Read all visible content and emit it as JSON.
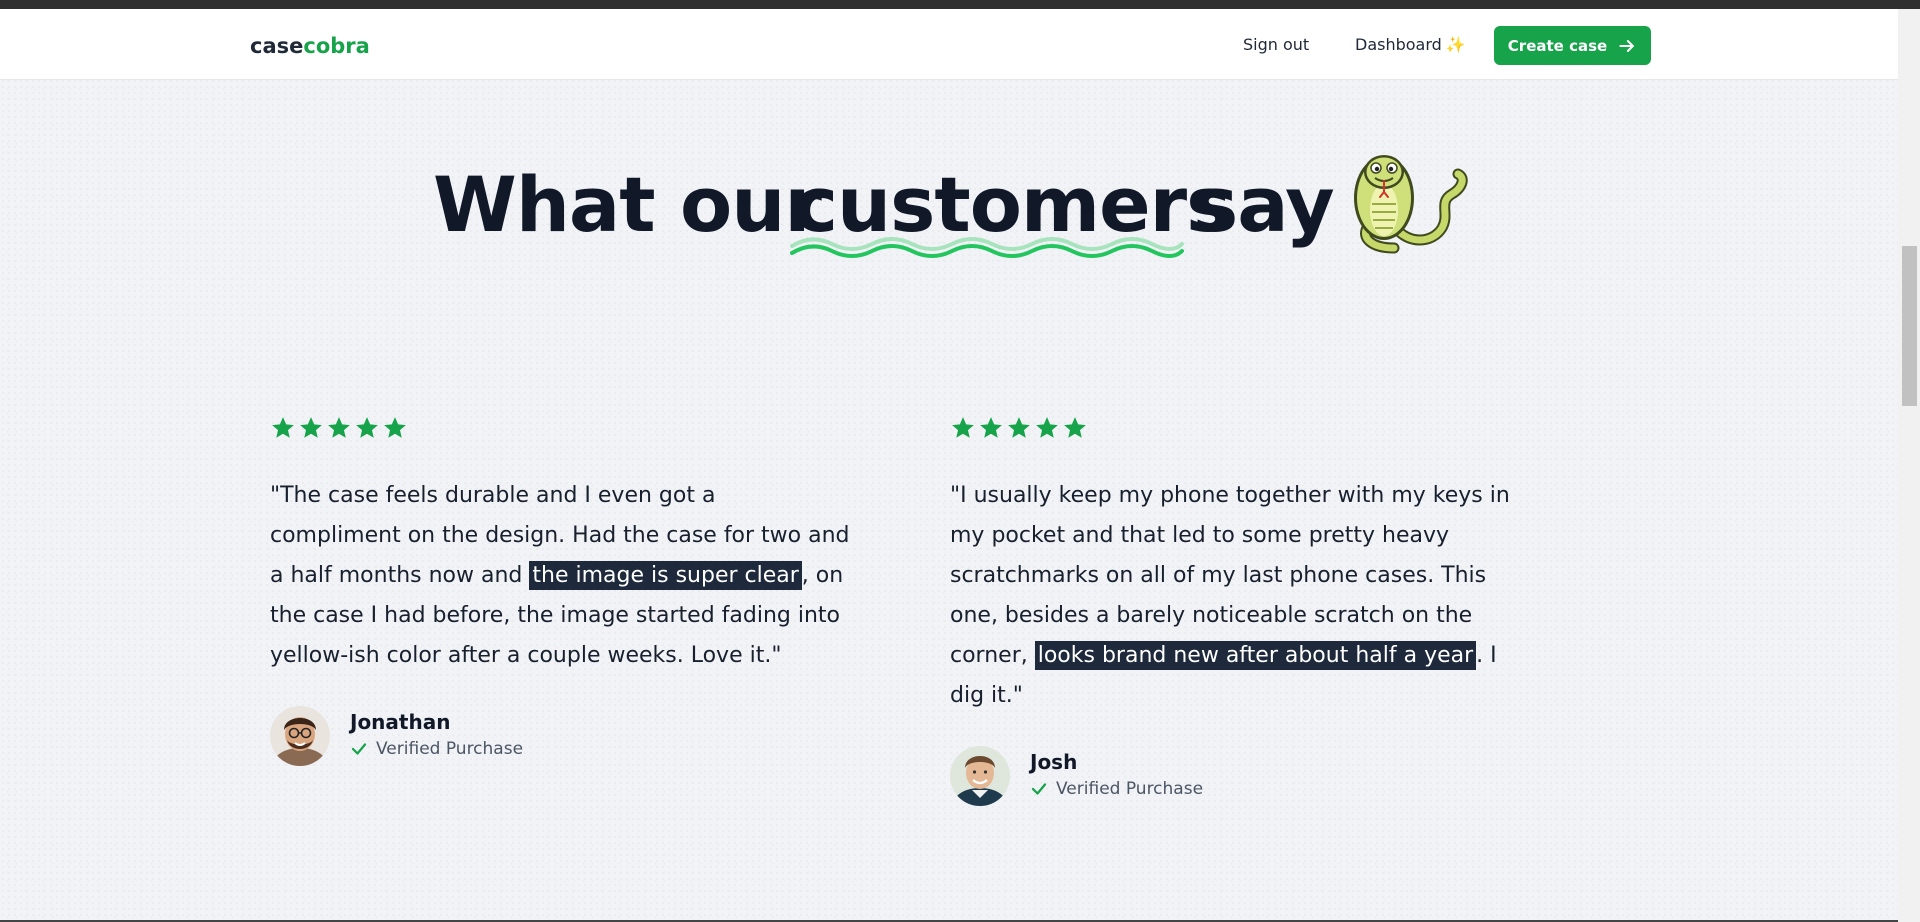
{
  "nav": {
    "logo_part1": "case",
    "logo_part2": "cobra",
    "signout": "Sign out",
    "dashboard": "Dashboard",
    "dashboard_icon": "✨",
    "create_case": "Create case"
  },
  "heading": {
    "part1": "What our",
    "highlight": "customers",
    "part2": "say"
  },
  "reviews": [
    {
      "rating": 5,
      "quote_before": "\"The case feels durable and I even got a compliment on the design. Had the case for two and a half months now and ",
      "quote_highlight": "the image is super clear",
      "quote_after": ", on the case I had before, the image started fading into yellow-ish color after a couple weeks. Love it.\"",
      "name": "Jonathan",
      "verified": "Verified Purchase"
    },
    {
      "rating": 5,
      "quote_before": "\"I usually keep my phone together with my keys in my pocket and that led to some pretty heavy scratchmarks on all of my last phone cases. This one, besides a barely noticeable scratch on the corner, ",
      "quote_highlight": "looks brand new after about half a year",
      "quote_after": ". I dig it.\"",
      "name": "Josh",
      "verified": "Verified Purchase"
    }
  ],
  "colors": {
    "brand_green": "#16a34a",
    "highlight_bg": "#1e293b",
    "heading": "#111827"
  }
}
